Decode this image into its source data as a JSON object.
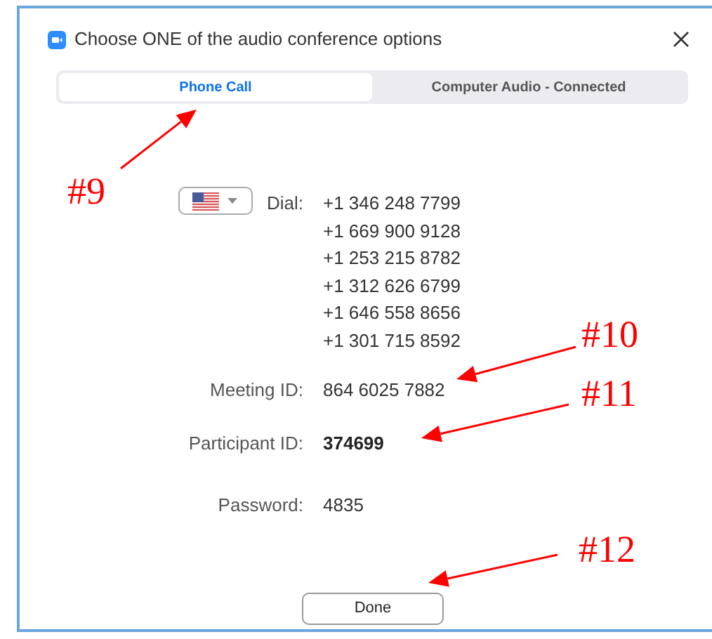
{
  "window": {
    "title": "Choose ONE of the audio conference options"
  },
  "tabs": [
    {
      "label": "Phone Call",
      "selected": true
    },
    {
      "label": "Computer Audio - Connected",
      "selected": false
    }
  ],
  "dial": {
    "label": "Dial:",
    "numbers": [
      "+1 346 248 7799",
      "+1 669 900 9128",
      "+1 253 215 8782",
      "+1 312 626 6799",
      "+1 646 558 8656",
      "+1 301 715 8592"
    ]
  },
  "fields": [
    {
      "label": "Meeting ID:",
      "value": "864 6025 7882",
      "bold": false
    },
    {
      "label": "Participant ID:",
      "value": "374699",
      "bold": true
    },
    {
      "label": "Password:",
      "value": "4835",
      "bold": false
    }
  ],
  "done_button": "Done",
  "annotations": [
    {
      "label": "#9"
    },
    {
      "label": "#10"
    },
    {
      "label": "#11"
    },
    {
      "label": "#12"
    }
  ]
}
